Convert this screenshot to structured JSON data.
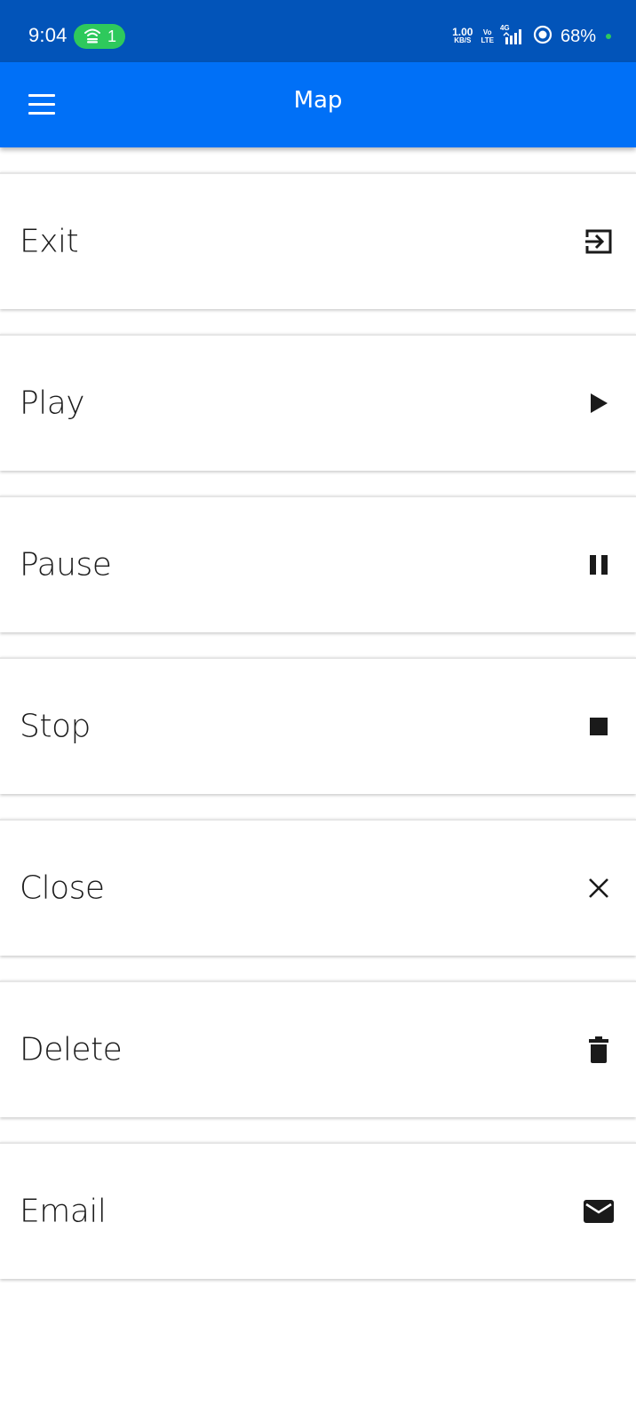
{
  "status_bar": {
    "time": "9:04",
    "hotspot_count": "1",
    "net_speed_value": "1.00",
    "net_speed_unit": "KB/S",
    "volte_top": "Vo",
    "volte_bottom": "LTE",
    "network_type": "4G",
    "battery": "68%",
    "accent_color": "#2ec95c"
  },
  "app_bar": {
    "title": "Map",
    "menu_icon": "menu-icon",
    "color": "#0070f7"
  },
  "items": [
    {
      "label": "Exit",
      "icon": "exit-icon"
    },
    {
      "label": "Play",
      "icon": "play-icon"
    },
    {
      "label": "Pause",
      "icon": "pause-icon"
    },
    {
      "label": "Stop",
      "icon": "stop-icon"
    },
    {
      "label": "Close",
      "icon": "close-icon"
    },
    {
      "label": "Delete",
      "icon": "delete-icon"
    },
    {
      "label": "Email",
      "icon": "email-icon"
    }
  ]
}
